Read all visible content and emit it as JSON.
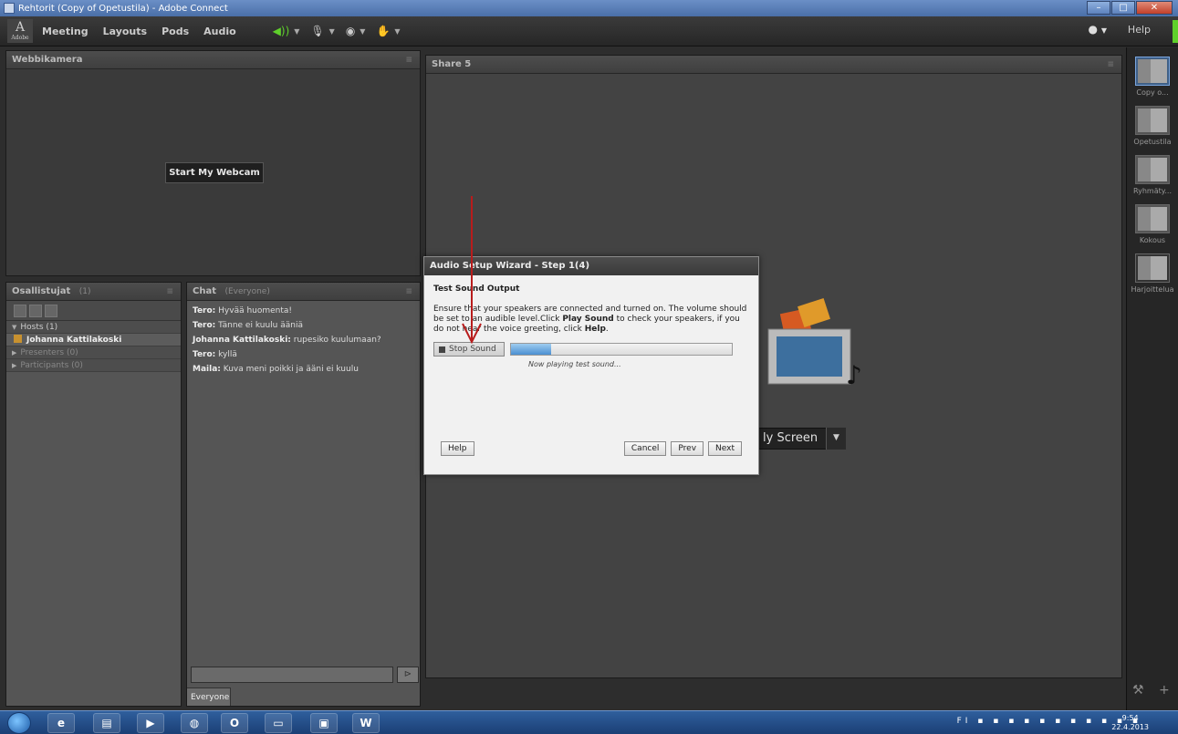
{
  "window": {
    "title": "Rehtorit (Copy of Opetustila) - Adobe Connect"
  },
  "menubar": {
    "logo_text": "Adobe",
    "items": [
      "Meeting",
      "Layouts",
      "Pods",
      "Audio"
    ],
    "help": "Help"
  },
  "webcam_pod": {
    "title": "Webbikamera",
    "start_button": "Start My Webcam"
  },
  "attendees_pod": {
    "title": "Osallistujat",
    "count": "(1)",
    "rows": [
      {
        "label": "Hosts (1)"
      },
      {
        "label": "Johanna Kattilakoski"
      },
      {
        "label": "Presenters (0)"
      },
      {
        "label": "Participants (0)"
      }
    ]
  },
  "chat_pod": {
    "title": "Chat",
    "scope": "(Everyone)",
    "messages": [
      {
        "who": "Tero:",
        "text": "Hyvää huomenta!"
      },
      {
        "who": "Tero:",
        "text": "Tänne ei kuulu ääniä"
      },
      {
        "who": "Johanna Kattilakoski:",
        "text": "rupesiko kuulumaan?"
      },
      {
        "who": "Tero:",
        "text": "kyllä"
      },
      {
        "who": "Maila:",
        "text": "Kuva meni poikki ja ääni ei kuulu"
      }
    ],
    "tab": "Everyone"
  },
  "share_pod": {
    "title": "Share 5",
    "share_button": "ly Screen"
  },
  "layouts": {
    "items": [
      {
        "label": "Copy o..."
      },
      {
        "label": "Opetustila"
      },
      {
        "label": "Ryhmäty..."
      },
      {
        "label": "Kokous"
      },
      {
        "label": "Harjoittelua"
      }
    ]
  },
  "wizard": {
    "title": "Audio Setup Wizard - Step 1(4)",
    "heading": "Test Sound Output",
    "text_1": "Ensure that your speakers are connected and turned on. The volume should be set to an audible level.Click ",
    "text_bold_1": "Play Sound",
    "text_2": " to check your speakers, if you do not hear the voice greeting, click ",
    "text_bold_2": "Help",
    "text_3": ".",
    "stop_button": "Stop Sound",
    "progress": 0.18,
    "progress_label": "Now playing test sound...",
    "help_button": "Help",
    "cancel_button": "Cancel",
    "prev_button": "Prev",
    "next_button": "Next"
  },
  "taskbar": {
    "tray_text": "FI",
    "time": "9:54",
    "date": "22.4.2013"
  },
  "colors": {
    "accent_green": "#5fd02b",
    "arrow_red": "#b81c1c"
  }
}
